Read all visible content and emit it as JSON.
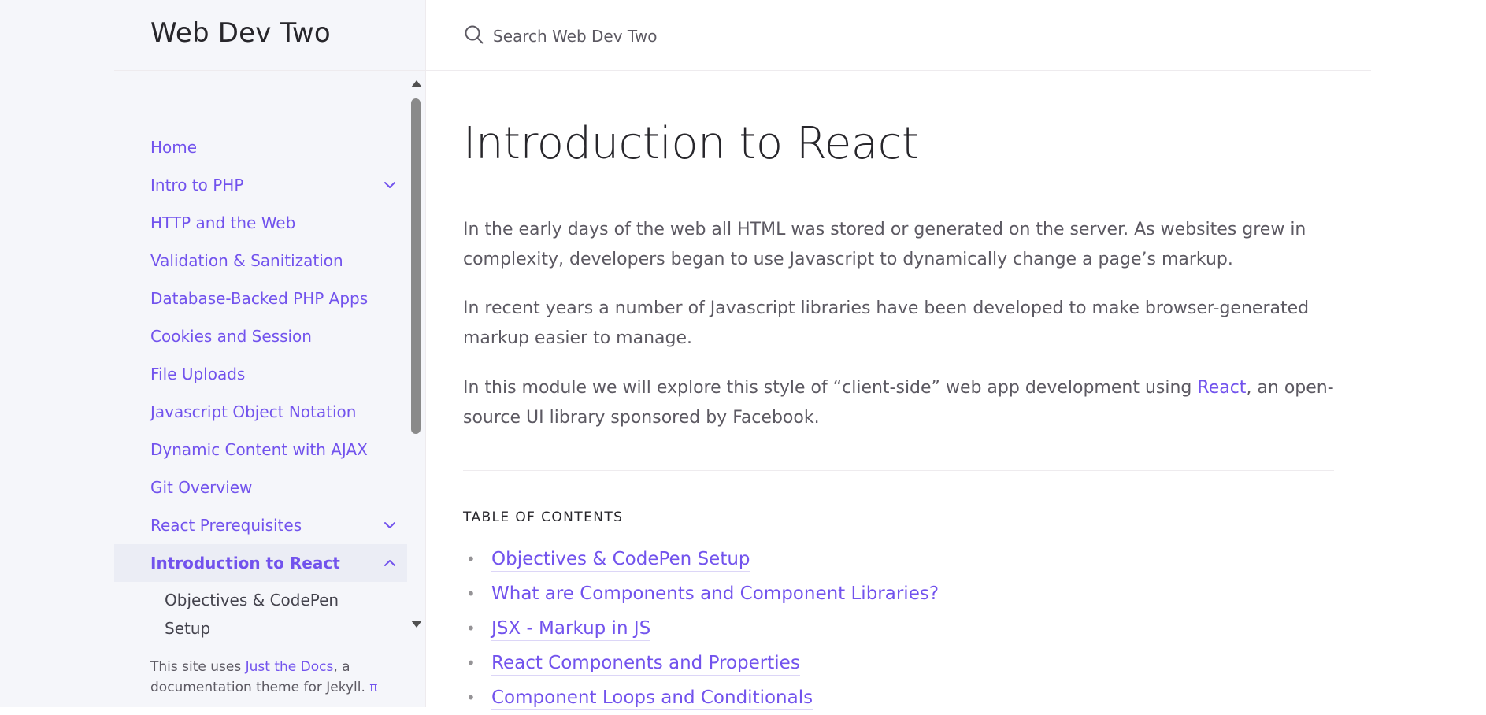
{
  "site": {
    "title": "Web Dev Two"
  },
  "search": {
    "placeholder": "Search Web Dev Two"
  },
  "nav": {
    "items": [
      {
        "label": "Home"
      },
      {
        "label": "Intro to PHP"
      },
      {
        "label": "HTTP and the Web"
      },
      {
        "label": "Validation & Sanitization"
      },
      {
        "label": "Database-Backed PHP Apps"
      },
      {
        "label": "Cookies and Session"
      },
      {
        "label": "File Uploads"
      },
      {
        "label": "Javascript Object Notation"
      },
      {
        "label": "Dynamic Content with AJAX"
      },
      {
        "label": "Git Overview"
      },
      {
        "label": "React Prerequisites"
      },
      {
        "label": "Introduction to React"
      }
    ],
    "sub_items": [
      {
        "label": "Objectives & CodePen Setup"
      }
    ]
  },
  "footer": {
    "prefix": "This site uses ",
    "link": "Just the Docs",
    "suffix": ", a documentation theme for Jekyll.",
    "pi": "π"
  },
  "main": {
    "title": "Introduction to React",
    "paragraphs": [
      "In the early days of the web all HTML was stored or generated on the server. As websites grew in complexity, developers began to use Javascript to dynamically change a page’s markup.",
      "In recent years a number of Javascript libraries have been developed to make browser-generated markup easier to manage."
    ],
    "para3": {
      "before": "In this module we will explore this style of “client-side” web app development using ",
      "link": "React",
      "after": ", an open-source UI library sponsored by Facebook."
    },
    "toc": {
      "heading": "Table of Contents",
      "bullet": "•",
      "items": [
        "Objectives & CodePen Setup",
        "What are Components and Component Libraries?",
        "JSX - Markup in JS",
        "React Components and Properties",
        "Component Loops and Conditionals"
      ]
    }
  },
  "colors": {
    "accent": "#7253ed",
    "sidebar_bg": "#f5f6fa",
    "active_bg": "#ebedf5",
    "text": "#5c5962",
    "heading": "#27262b"
  },
  "icons": {
    "search": "search-icon",
    "chevron_down": "chevron-down-icon",
    "chevron_up": "chevron-up-icon"
  }
}
